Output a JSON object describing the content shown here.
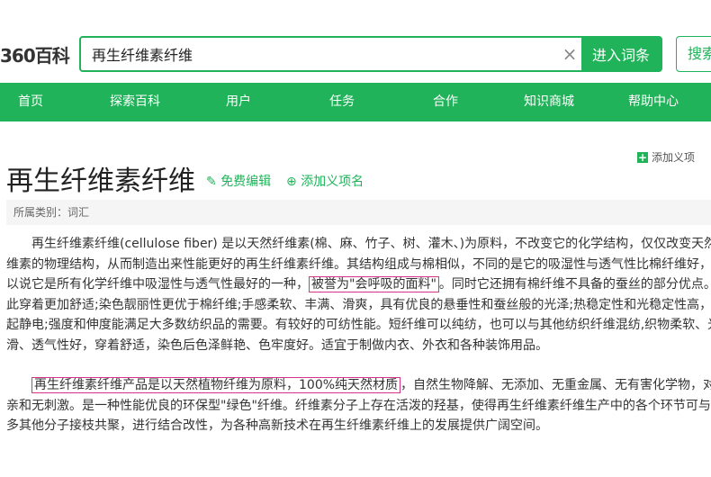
{
  "logo": "360百科",
  "search": {
    "value": "再生纤维素纤维",
    "enter_label": "进入词条",
    "search_label": "搜索"
  },
  "nav": [
    "首页",
    "探索百科",
    "用户",
    "任务",
    "合作",
    "知识商城",
    "帮助中心"
  ],
  "add_top": "添加义项",
  "title": "再生纤维素纤维",
  "edit": "免费编辑",
  "add_name": "添加义项名",
  "category": "所属类别：词汇",
  "para1": {
    "l1": "再生纤维素纤维(cellulose fiber) 是以天然纤维素(棉、麻、竹子、树、灌木、)为原料，不改变它的化学结构，仅仅改变天然纤",
    "l2": "维素的物理结构，从而制造出来性能更好的再生纤维素纤维。其结构组成与棉相似，不同的是它的吸湿性与透气性比棉纤维好，可",
    "l3a": "以说它是所有化学纤维中吸湿性与透气性最好的一种，",
    "l3hl": "被誉为\"会呼吸的面料\"",
    "l3b": "。同时它还拥有棉纤维不具备的蚕丝的部分优点。因",
    "l4": "此穿着更加舒适;染色靓丽性更优于棉纤维;手感柔软、丰满、滑爽，具有优良的悬垂性和蚕丝般的光泽;热稳定性和光稳定性高，不",
    "l5": "起静电;强度和伸度能满足大多数纺织品的需要。有较好的可纺性能。短纤维可以纯纺，也可以与其他纺织纤维混纺,织物柔软、光",
    "l6": "滑、透气性好，穿着舒适，染色后色泽鲜艳、色牢度好。适宜于制做内衣、外衣和各种装饰用品。"
  },
  "para2": {
    "l1hl": "再生纤维素纤维产品是以天然植物纤维为原料，100%纯天然材质",
    "l1b": "，自然生物降解、无添加、无重金属、无有害化学物，对皮肤",
    "l2": "亲和无刺激。是一种性能优良的环保型\"绿色\"纤维。纤维素分子上存在活泼的羟基，使得再生纤维素纤维生产中的各个环节可与许",
    "l3": "多其他分子接枝共聚，进行结合改性，为各种高新技术在再生纤维素纤维上的发展提供广阔空间。"
  }
}
